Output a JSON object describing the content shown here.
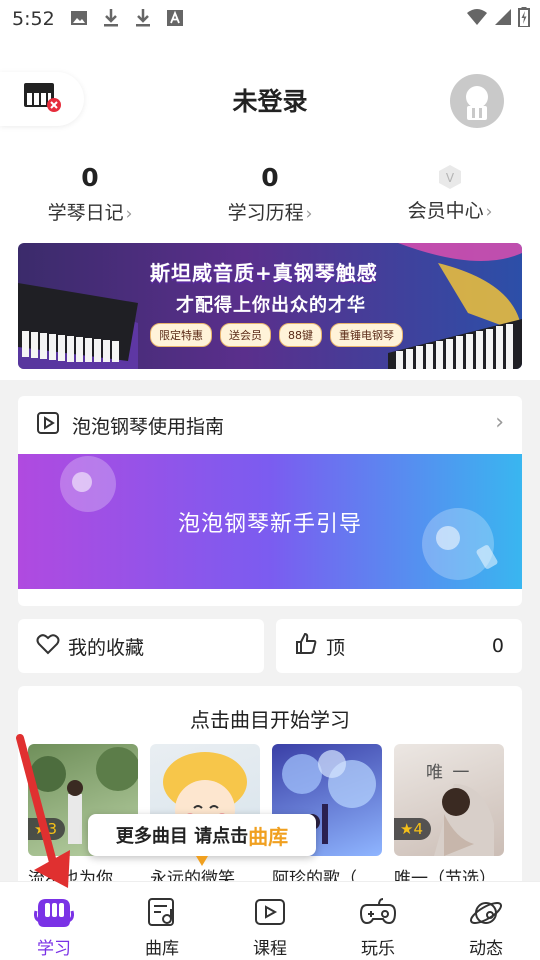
{
  "status_bar": {
    "time": "5:52",
    "icons": [
      "image-icon",
      "download-icon",
      "download-icon",
      "text-a-icon",
      "wifi-icon",
      "signal-icon",
      "battery-icon"
    ]
  },
  "header": {
    "title": "未登录"
  },
  "stats": [
    {
      "value": "0",
      "label": "学琴日记"
    },
    {
      "value": "0",
      "label": "学习历程"
    },
    {
      "value": "",
      "label": "会员中心",
      "badge": "V"
    }
  ],
  "promo_banner": {
    "headline": "斯坦威音质+真钢琴触感",
    "subline": "才配得上你出众的才华",
    "tags": [
      "限定特惠",
      "送会员",
      "88键",
      "重锤电钢琴"
    ]
  },
  "guide": {
    "row_label": "泡泡钢琴使用指南",
    "banner_text": "泡泡钢琴新手引导"
  },
  "favorites": {
    "label": "我的收藏"
  },
  "likes": {
    "label": "顶",
    "count": "0"
  },
  "songs_section": {
    "title": "点击曲目开始学习",
    "songs": [
      {
        "name": "流星也为你",
        "stars": "★3",
        "colors": [
          "#6f8f5a",
          "#b9d1a4"
        ]
      },
      {
        "name": "永远的微笑",
        "stars": "",
        "colors": [
          "#f3d9a0",
          "#f7b24a"
        ]
      },
      {
        "name": "阿珍的歌（",
        "stars": "",
        "colors": [
          "#3a3fa6",
          "#8fb5ff"
        ]
      },
      {
        "name": "唯一（节选）",
        "stars": "★4",
        "colors": [
          "#e8e2de",
          "#b8a9a2"
        ]
      }
    ],
    "cover_text_4": "唯 一"
  },
  "tooltip": {
    "prefix": "更多曲目 请点击",
    "highlight": "曲库"
  },
  "bottom_nav": [
    {
      "label": "学习",
      "active": true
    },
    {
      "label": "曲库",
      "active": false
    },
    {
      "label": "课程",
      "active": false
    },
    {
      "label": "玩乐",
      "active": false
    },
    {
      "label": "动态",
      "active": false
    }
  ],
  "colors": {
    "accent": "#7a32e6",
    "highlight": "#f0a020",
    "arrow": "#e03030"
  }
}
